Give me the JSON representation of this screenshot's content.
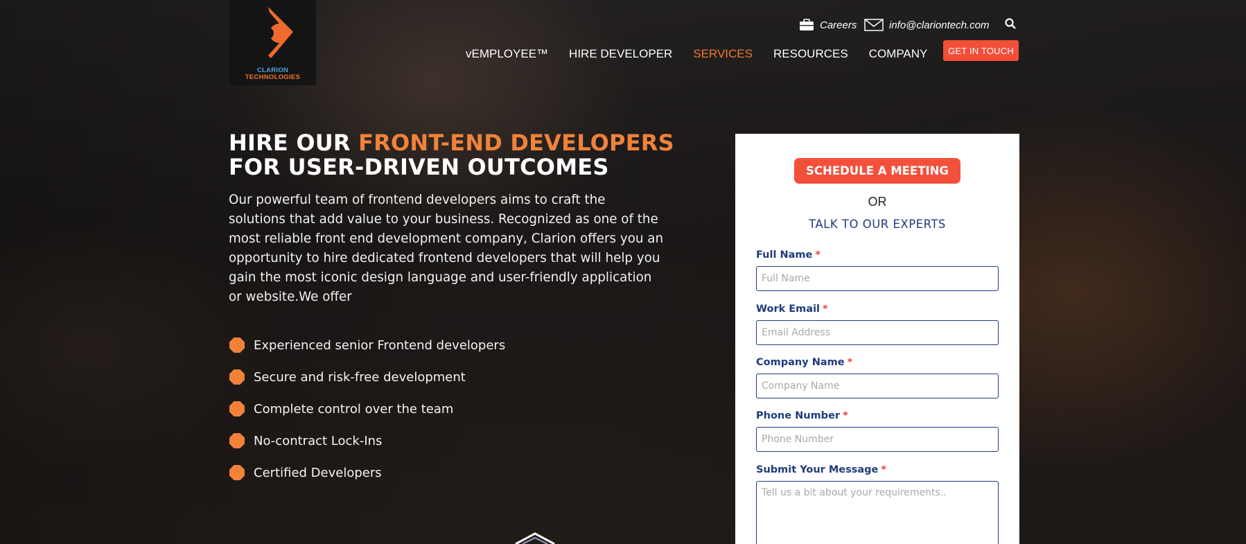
{
  "brand": {
    "logo_line1": "CLARION",
    "logo_line2": "TECHNOLOGIES",
    "accent": "#f0823a",
    "cta_red": "#f3503b",
    "form_blue": "#1f3b7c"
  },
  "utility": {
    "careers_label": "Careers",
    "email_label": "info@clariontech.com",
    "icons": [
      "briefcase-icon",
      "mail-icon",
      "search-icon"
    ]
  },
  "nav": {
    "items": [
      {
        "label": "vEMPLOYEE™",
        "active": false
      },
      {
        "label": "HIRE DEVELOPER",
        "active": false
      },
      {
        "label": "SERVICES",
        "active": true
      },
      {
        "label": "RESOURCES",
        "active": false
      },
      {
        "label": "COMPANY",
        "active": false
      }
    ],
    "cta_label": "GET IN TOUCH"
  },
  "hero": {
    "headline_part1": "HIRE OUR ",
    "headline_accent": "FRONT-END DEVELOPERS",
    "headline_line2": "FOR USER-DRIVEN OUTCOMES",
    "intro": "Our powerful team of frontend developers aims to craft the solutions that add value to your business. Recognized as one of the most reliable front end development company, Clarion offers you an opportunity to hire dedicated frontend developers that will help you gain the most iconic design language and user-friendly application or website.We offer",
    "bullets": [
      "Experienced senior Frontend developers",
      "Secure and risk-free development",
      "Complete control over the team",
      "No-contract Lock-Ins",
      "Certified Developers"
    ]
  },
  "form": {
    "schedule_label": "SCHEDULE A MEETING",
    "or_label": "OR",
    "talk_label": "TALK TO OUR EXPERTS",
    "required_mark": "*",
    "fields": {
      "full_name": {
        "label": "Full Name",
        "placeholder": "Full Name",
        "value": ""
      },
      "work_email": {
        "label": "Work Email",
        "placeholder": "Email Address",
        "value": ""
      },
      "company_name": {
        "label": "Company Name",
        "placeholder": "Company Name",
        "value": ""
      },
      "phone_number": {
        "label": "Phone Number",
        "placeholder": "Phone Number",
        "value": ""
      },
      "message": {
        "label": "Submit Your Message",
        "placeholder": "Tell us a bit about your requirements..",
        "value": ""
      }
    }
  }
}
